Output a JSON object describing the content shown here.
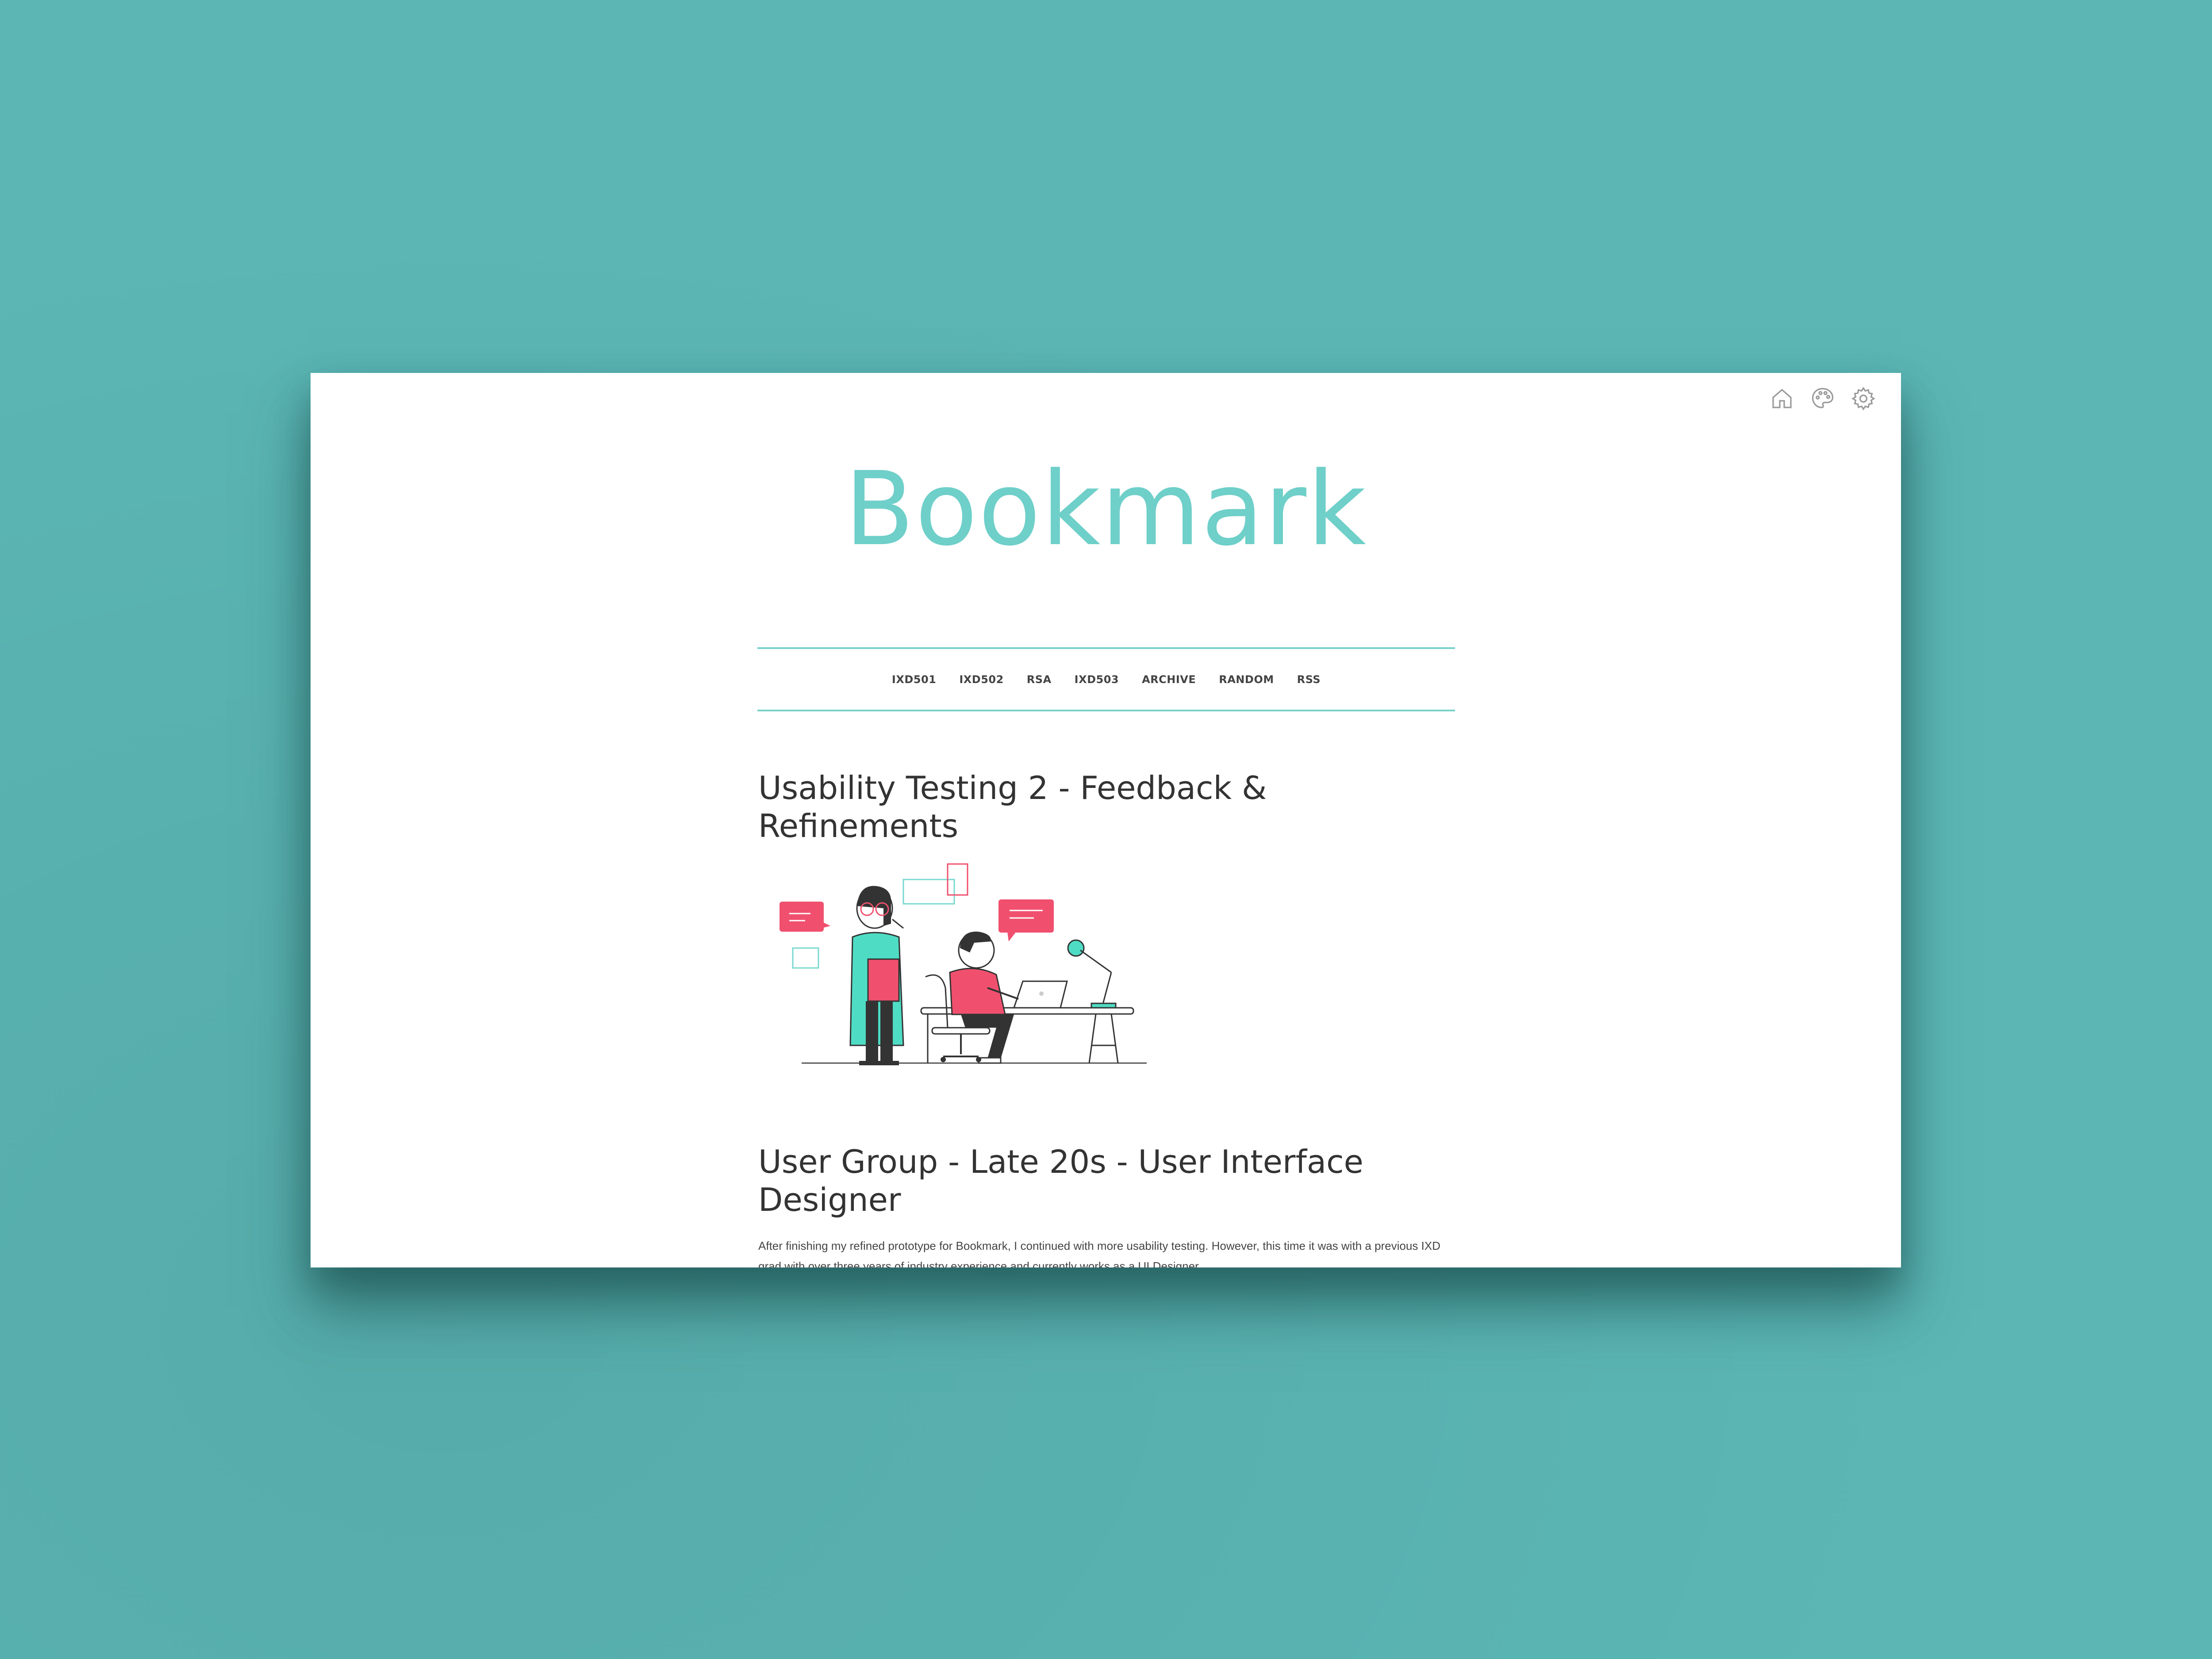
{
  "header": {
    "icons": [
      "home-icon",
      "palette-icon",
      "gear-icon"
    ]
  },
  "blog": {
    "title": "Bookmark"
  },
  "nav": {
    "items": [
      "IXD501",
      "IXD502",
      "RSA",
      "IXD503",
      "ARCHIVE",
      "RANDOM",
      "RSS"
    ]
  },
  "post": {
    "title": "Usability Testing 2 - Feedback & Refinements",
    "section_heading": "User Group - Late 20s -  User Interface Designer",
    "body": "After finishing my refined prototype for Bookmark, I continued with more usability testing. However, this time it was with a previous IXD grad with over three years of industry experience and currently works as a UI Designer."
  },
  "colors": {
    "background": "#5bb6b4",
    "accent": "#6fcfc9",
    "highlight": "#f0506e"
  }
}
